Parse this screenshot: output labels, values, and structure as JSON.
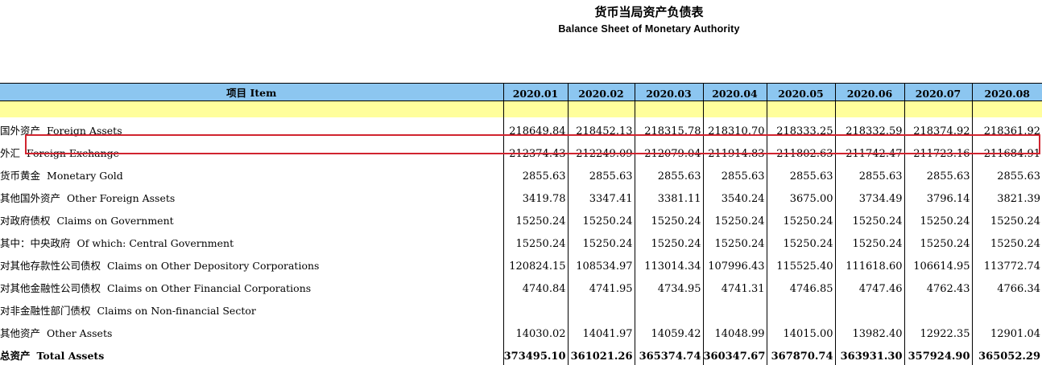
{
  "title": {
    "cn": "货币当局资产负债表",
    "en": "Balance Sheet of  Monetary Authority"
  },
  "header": {
    "item": "项目 Item",
    "periods": [
      "2020.01",
      "2020.02",
      "2020.03",
      "2020.04",
      "2020.05",
      "2020.06",
      "2020.07",
      "2020.08"
    ]
  },
  "colors": {
    "header_bg": "#8cc6f0",
    "band_bg": "#fffe9c",
    "highlight_border": "#d1242f"
  },
  "rows": [
    {
      "cn": "国外资产",
      "en": "Foreign Assets",
      "values": [
        "218649.84",
        "218452.13",
        "218315.78",
        "218310.70",
        "218333.25",
        "218332.59",
        "218374.92",
        "218361.92"
      ]
    },
    {
      "cn": "外汇",
      "en": "Foreign Exchange",
      "values": [
        "212374.43",
        "212249.09",
        "212079.04",
        "211914.83",
        "211802.63",
        "211742.47",
        "211723.16",
        "211684.91"
      ]
    },
    {
      "cn": "货币黄金",
      "en": "Monetary Gold",
      "values": [
        "2855.63",
        "2855.63",
        "2855.63",
        "2855.63",
        "2855.63",
        "2855.63",
        "2855.63",
        "2855.63"
      ]
    },
    {
      "cn": "其他国外资产",
      "en": "Other Foreign Assets",
      "values": [
        "3419.78",
        "3347.41",
        "3381.11",
        "3540.24",
        "3675.00",
        "3734.49",
        "3796.14",
        "3821.39"
      ]
    },
    {
      "cn": "对政府债权",
      "en": "Claims on Government",
      "values": [
        "15250.24",
        "15250.24",
        "15250.24",
        "15250.24",
        "15250.24",
        "15250.24",
        "15250.24",
        "15250.24"
      ]
    },
    {
      "cn": "其中：中央政府",
      "en": "Of which: Central Government",
      "values": [
        "15250.24",
        "15250.24",
        "15250.24",
        "15250.24",
        "15250.24",
        "15250.24",
        "15250.24",
        "15250.24"
      ]
    },
    {
      "cn": "对其他存款性公司债权",
      "en": "Claims on Other Depository Corporations",
      "values": [
        "120824.15",
        "108534.97",
        "113014.34",
        "107996.43",
        "115525.40",
        "111618.60",
        "106614.95",
        "113772.74"
      ]
    },
    {
      "cn": "对其他金融性公司债权",
      "en": "Claims on Other Financial Corporations",
      "values": [
        "4740.84",
        "4741.95",
        "4734.95",
        "4741.31",
        "4746.85",
        "4747.46",
        "4762.43",
        "4766.34"
      ]
    },
    {
      "cn": "对非金融性部门债权",
      "en": "Claims on Non-financial Sector",
      "values": [
        "",
        "",
        "",
        "",
        "",
        "",
        "",
        ""
      ]
    },
    {
      "cn": "其他资产",
      "en": "Other Assets",
      "values": [
        "14030.02",
        "14041.97",
        "14059.42",
        "14048.99",
        "14015.00",
        "13982.40",
        "12922.35",
        "12901.04"
      ]
    },
    {
      "cn": "总资产",
      "en": "Total Assets",
      "values": [
        "373495.10",
        "361021.26",
        "365374.74",
        "360347.67",
        "367870.74",
        "363931.30",
        "357924.90",
        "365052.29"
      ]
    }
  ]
}
